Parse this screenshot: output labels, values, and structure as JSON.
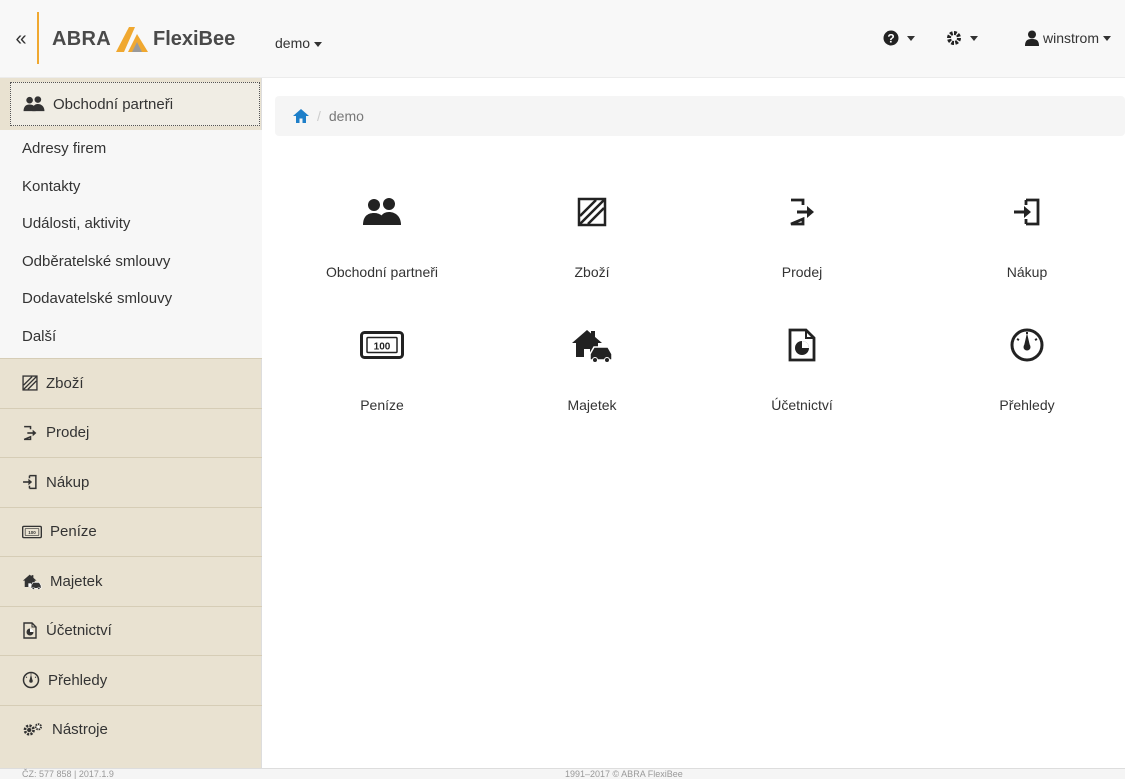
{
  "navbar": {
    "collapse": "«",
    "brand_left": "ABRA",
    "brand_right": "FlexiBee",
    "database": "demo",
    "user": "winstrom"
  },
  "breadcrumb": {
    "current": "demo"
  },
  "sidebar": {
    "active": "Obchodní partneři",
    "submenu": [
      "Adresy firem",
      "Kontakty",
      "Události, aktivity",
      "Odběratelské smlouvy",
      "Dodavatelské smlouvy",
      "Další"
    ],
    "items": [
      "Zboží",
      "Prodej",
      "Nákup",
      "Peníze",
      "Majetek",
      "Účetnictví",
      "Přehledy",
      "Nástroje"
    ]
  },
  "tiles": [
    "Obchodní partneři",
    "Zboží",
    "Prodej",
    "Nákup",
    "Peníze",
    "Majetek",
    "Účetnictví",
    "Přehledy"
  ],
  "footer": {
    "left": "ČZ: 577 858 | 2017.1.9",
    "center": "1991–2017 © ABRA FlexiBee"
  },
  "colors": {
    "accent": "#f0a830",
    "sidebar_bg": "#e9e2d1",
    "icon": "#222222"
  }
}
